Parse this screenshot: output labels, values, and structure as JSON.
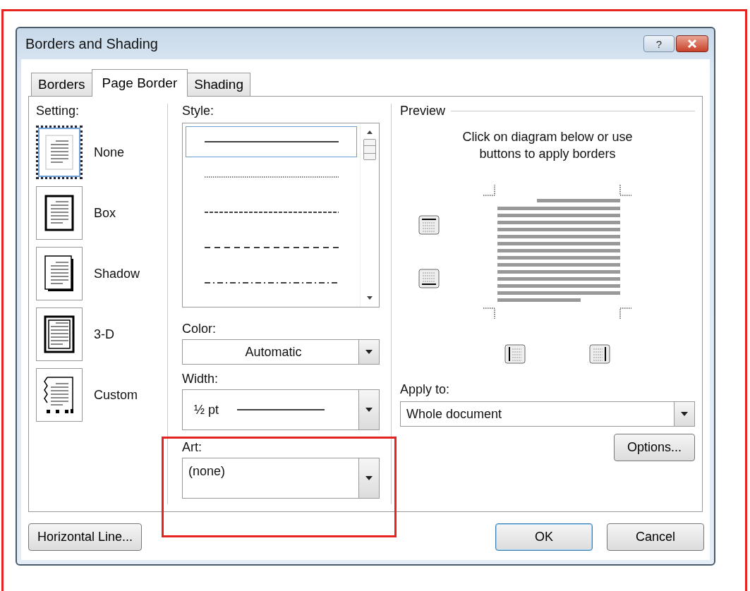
{
  "window": {
    "title": "Borders and Shading",
    "help_button": "?"
  },
  "tabs": [
    {
      "label": "Borders",
      "selected": false
    },
    {
      "label": "Page Border",
      "selected": true
    },
    {
      "label": "Shading",
      "selected": false
    }
  ],
  "setting": {
    "label": "Setting:",
    "options": [
      {
        "kind": "none",
        "label": "None",
        "selected": true
      },
      {
        "kind": "box",
        "label": "Box",
        "selected": false
      },
      {
        "kind": "shadow",
        "label": "Shadow",
        "selected": false
      },
      {
        "kind": "threed",
        "label": "3-D",
        "selected": false
      },
      {
        "kind": "custom",
        "label": "Custom",
        "selected": false
      }
    ]
  },
  "style": {
    "label": "Style:",
    "lines": [
      {
        "kind": "solid",
        "selected": true
      },
      {
        "kind": "dotted",
        "selected": false
      },
      {
        "kind": "dashed",
        "selected": false
      },
      {
        "kind": "dashed-wide",
        "selected": false
      },
      {
        "kind": "dash-dot",
        "selected": false
      }
    ]
  },
  "color": {
    "label": "Color:",
    "value": "Automatic"
  },
  "width": {
    "label": "Width:",
    "value": "½ pt"
  },
  "art": {
    "label": "Art:",
    "value": "(none)"
  },
  "preview": {
    "label": "Preview",
    "hint": "Click on diagram below or use buttons to apply borders"
  },
  "apply_to": {
    "label": "Apply to:",
    "value": "Whole document"
  },
  "buttons": {
    "options": "Options...",
    "horizontal_line": "Horizontal Line...",
    "ok": "OK",
    "cancel": "Cancel"
  }
}
